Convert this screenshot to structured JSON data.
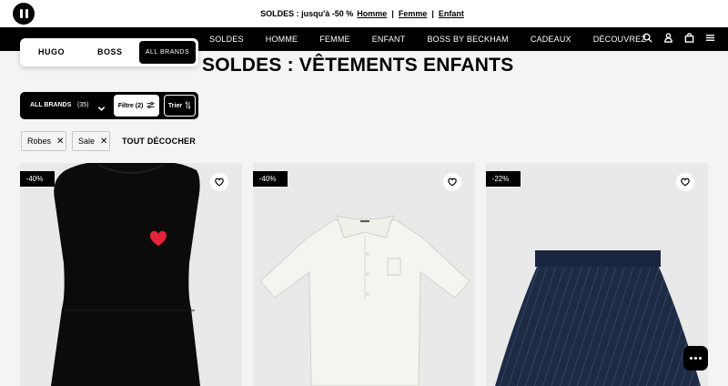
{
  "promo": {
    "text": "SOLDES : jusqu'à -50 %",
    "links": [
      "Homme",
      "Femme",
      "Enfant"
    ],
    "sep": "|"
  },
  "nav": {
    "items": [
      "SOLDES",
      "HOMME",
      "FEMME",
      "ENFANT",
      "BOSS BY BECKHAM",
      "CADEAUX",
      "DÉCOUVREZ"
    ],
    "icons": [
      "search-icon",
      "account-icon",
      "bag-icon",
      "menu-icon"
    ]
  },
  "brands": {
    "hugo": "HUGO",
    "boss": "BOSS",
    "all": "ALL BRANDS"
  },
  "page_title": "SOLDES : VÊTEMENTS ENFANTS",
  "filters": {
    "all_brands": "ALL BRANDS",
    "count": "(35)",
    "filter_label": "Filtre (2)",
    "sort_label": "Trier"
  },
  "chips": {
    "robes": "Robes",
    "sale": "Sale",
    "clear_all": "TOUT DÉCOCHER"
  },
  "products": [
    {
      "discount": "-40%"
    },
    {
      "discount": "-40%"
    },
    {
      "discount": "-22%"
    }
  ],
  "colors": {
    "accent": "#000000",
    "background": "#f4f4f4",
    "card_background": "#e9e9e9",
    "heart_logo": "#e3243b"
  }
}
